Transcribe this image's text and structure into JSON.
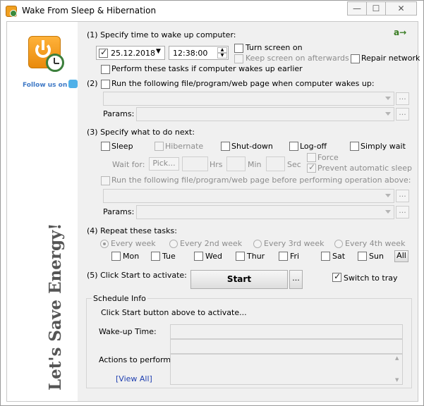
{
  "window": {
    "title": "Wake From Sleep & Hibernation",
    "min_icon": "minimize-icon",
    "max_icon": "maximize-icon",
    "close_icon": "close-icon",
    "min": "—",
    "max": "☐",
    "close": "✕"
  },
  "sidebar": {
    "follow_text": "Follow us on",
    "slogan": "Let's Save Energy!"
  },
  "lang_icon": "a→",
  "step1": {
    "heading": "(1) Specify time to wake up computer:",
    "date": "25.12.2018",
    "time": "12:38:00",
    "turn_screen_on": "Turn screen on",
    "keep_screen_on": "Keep screen on afterwards",
    "repair_network": "Repair network",
    "perform_if_earlier": "Perform these tasks if computer wakes up earlier"
  },
  "step2": {
    "heading": "Run the following file/program/web page when computer wakes up:",
    "number": "(2)",
    "file_value": "",
    "browse": "...",
    "params_label": "Params:",
    "params_value": "",
    "params_browse": "..."
  },
  "step3": {
    "heading": "(3) Specify what to do next:",
    "sleep": "Sleep",
    "hibernate": "Hibernate",
    "shutdown": "Shut-down",
    "logoff": "Log-off",
    "simply_wait": "Simply wait",
    "wait_for": "Wait for:",
    "pick": "Pick...",
    "hrs": "Hrs",
    "min": "Min",
    "sec": "Sec",
    "force": "Force",
    "prevent_sleep": "Prevent automatic sleep",
    "run_before": "Run the following file/program/web page before performing operation above:",
    "file_value": "",
    "browse": "...",
    "params_label": "Params:",
    "params_value": "",
    "params_browse": "..."
  },
  "step4": {
    "heading": "(4) Repeat these tasks:",
    "every_week": "Every week",
    "every_2nd_week": "Every 2nd week",
    "every_3rd_week": "Every 3rd week",
    "every_4th_week": "Every 4th week",
    "days": [
      "Mon",
      "Tue",
      "Wed",
      "Thur",
      "Fri",
      "Sat",
      "Sun"
    ],
    "all": "All"
  },
  "step5": {
    "heading": "(5) Click Start to activate:",
    "start": "Start",
    "more": "...",
    "switch_to_tray": "Switch to tray"
  },
  "schedule": {
    "title": "Schedule Info",
    "hint": "Click Start button above to activate...",
    "wakeup_label": "Wake-up Time:",
    "wakeup_value": "",
    "actions_label": "Actions to perform:",
    "actions_value": "",
    "view_all": "[View All]"
  }
}
